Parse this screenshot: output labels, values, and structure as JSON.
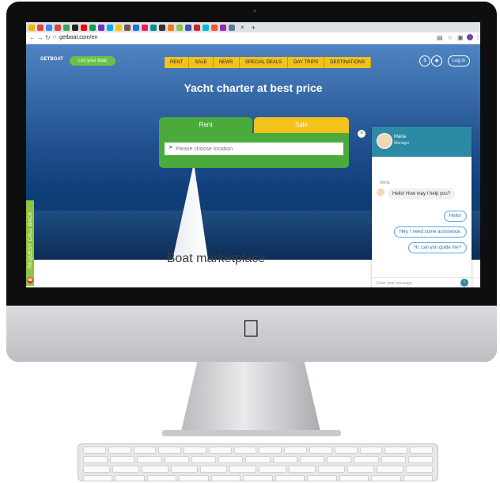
{
  "browser": {
    "url": "getboat.com/en",
    "tab_close": "×",
    "new_tab": "+"
  },
  "site": {
    "logo": "GETBOAT",
    "list_boat_button": "List your boat",
    "nav": [
      "RENT",
      "SALE",
      "NEWS",
      "SPECIAL DEALS",
      "DAY TRIPS",
      "DESTINATIONS"
    ],
    "currency_button": "$",
    "login_button": "Log in",
    "headline": "Yacht charter at best price",
    "search": {
      "tab_rent": "Rent",
      "tab_sale": "Sale",
      "placeholder": "Please choose location"
    },
    "callback_label": "REQUEST CALL BACK",
    "marketplace_title": "Boat marketplace"
  },
  "chat": {
    "agent_name": "Maria",
    "agent_role": "Manager",
    "agent_label": "Maria",
    "messages_in": [
      "Hello! How may I help you?"
    ],
    "messages_out": [
      "Hello!",
      "Hey, I need some assistance.",
      "Hi, can you guide me?"
    ],
    "input_placeholder": "Enter your message..."
  },
  "colors": {
    "accent_yellow": "#f2c31d",
    "accent_green": "#4aab3c",
    "chat_header": "#2d8aa5"
  }
}
